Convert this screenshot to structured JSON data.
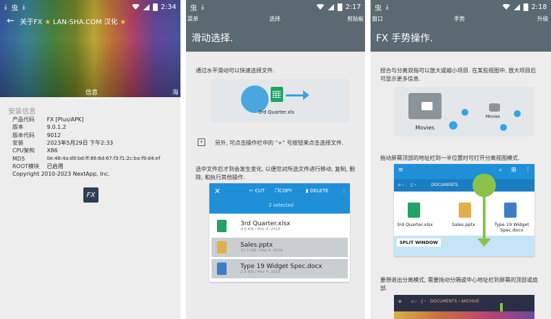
{
  "panel1": {
    "status": {
      "left_icons": [
        "download-icon",
        "bug-icon",
        "download-icon"
      ],
      "time": "2:34"
    },
    "title": "关于FX",
    "title_suffix": "LAN-SHA.COM 汉化",
    "tab_active": "信息",
    "tab_right": "海",
    "section": "安装信息",
    "rows": [
      {
        "k": "产品代码",
        "v": "FX [Plus/APK]"
      },
      {
        "k": "版本",
        "v": "9.0.1.2"
      },
      {
        "k": "版本代码",
        "v": "9012"
      },
      {
        "k": "安装",
        "v": "2023年5月29日 下午2:33"
      },
      {
        "k": "CPU架构",
        "v": "X86"
      },
      {
        "k": "MD5",
        "v": "0e:48:4a:d9:bd:ff:86:6d:67:f3:f1:2c:ba:f9:d4:ef"
      },
      {
        "k": "ROOT模块",
        "v": "已启用"
      }
    ],
    "copyright": "Copyright 2010-2023 NextApp, Inc.",
    "logo": "FX"
  },
  "panel2": {
    "status_time": "2:17",
    "action_left": "菜单",
    "action_mid": "选择",
    "action_right": "剪贴板",
    "title": "滑动选择.",
    "desc1": "通过水平滑动可以快速选择文件.",
    "demo_file": "3rd Quarter.xls",
    "desc2": "另外, 可点击操作栏中的 \"+\" 号按钮来点击选择文件.",
    "desc3a": "选中文件后才到会发生变化, 以便您对所选文件进行移动, 复制, 删",
    "desc3b": "除, 和执行其他操作.",
    "bar_close": "✕",
    "bar_cut": "CUT",
    "bar_copy": "COPY",
    "bar_delete": "DELETE",
    "bar_count": "2 selected",
    "files": [
      {
        "name": "3rd Quarter.xlsx",
        "meta": "4.0 KiB / Mar 4, 2018",
        "color": "#21a366",
        "selected": false
      },
      {
        "name": "Sales.pptx",
        "meta": "31.7 KiB / Mar 4, 2018",
        "color": "#e0b04a",
        "selected": true
      },
      {
        "name": "Type 19 Widget Spec.docx",
        "meta": "2.5 KiB / Mar 4, 2018",
        "color": "#3d7ec9",
        "selected": true
      }
    ]
  },
  "panel3": {
    "status_time": "2:18",
    "action_left": "窗口",
    "action_mid": "手势",
    "action_right": "升级",
    "title": "FX 手势操作.",
    "desc1a": "捏合与分离双指可以放大或缩小项目. 在某些视图中, 放大项目后",
    "desc1b": "可显示更多信息.",
    "folder_big_label": "Movies",
    "folder_small_label": "Movies",
    "desc2": "拖动屏幕顶部的地址栏到一半位置时可打开分离视图模式.",
    "path_label": "DOCUMENTS",
    "split_files": [
      "3rd Quarter.xlsx",
      "Sales.pptx",
      "Type 19 Widget Spec.docx"
    ],
    "split_label": "SPLIT WINDOW",
    "desc3a": "要想退出分离模式, 需要拖动分隔或中心地址栏到屏幕的顶部或底",
    "desc3b": "部.",
    "bottom_path1": "DOCUMENTS",
    "bottom_path2": "ARCHIVE"
  }
}
